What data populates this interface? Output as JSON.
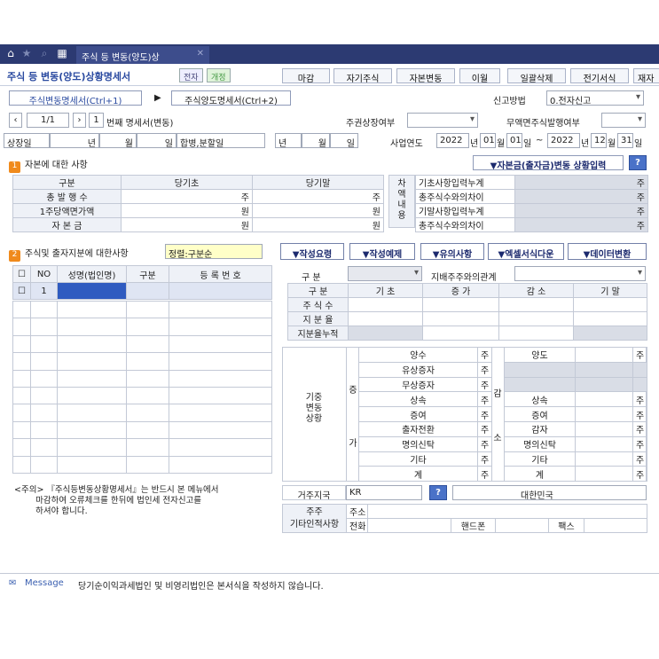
{
  "tab": {
    "title": "주식 등 변동(양도)상",
    "close": "✕"
  },
  "header": {
    "title": "주식 등 변동(양도)상황명세서",
    "badge1": "전자",
    "badge2": "개정",
    "buttons": [
      "마감",
      "자기주식",
      "자본변동",
      "이월",
      "일괄삭제",
      "전기서식",
      "재자"
    ]
  },
  "nav": {
    "form1": "주식변동명세서(Ctrl+1)",
    "arrow": "▶",
    "form2": "주식양도명세서(Ctrl+2)",
    "report_label": "신고방법",
    "report_value": "0.전자신고"
  },
  "pager": {
    "current": "1/1",
    "num": "1",
    "label": "번째 명세서(변동)",
    "listed_label": "주권상장여부",
    "scrip_label": "무액면주식발행여부"
  },
  "dates": {
    "listed": "상장일",
    "year": "년",
    "month": "월",
    "day": "일",
    "merge": "합병,분할일",
    "year2": "년",
    "month2": "월",
    "day2": "일",
    "fiscal_label": "사업연도",
    "y1": "2022",
    "m1": "01",
    "d1": "01",
    "y2": "2022",
    "m2": "12",
    "d2": "31",
    "tilde": "~",
    "yl": "년",
    "ml": "월",
    "dl": "일"
  },
  "capital": {
    "section_num": "1",
    "section": "자본에 대한 사항",
    "input_btn": "▼자본금(출자금)변동 상황입력",
    "q": "?",
    "headers": [
      "구분",
      "당기초",
      "당기말"
    ],
    "rows": [
      {
        "label": "총 발 행 수",
        "unit": "주"
      },
      {
        "label": "1주당액면가액",
        "unit": "원"
      },
      {
        "label": "자 본 금",
        "unit": "원"
      }
    ],
    "diff_label": [
      "차",
      "액",
      "내",
      "용"
    ],
    "diff_rows": [
      {
        "label": "기초사항입력누계",
        "unit": "주"
      },
      {
        "label": "총주식수와의차이",
        "unit": "주"
      },
      {
        "label": "기말사항입력누계",
        "unit": "주"
      },
      {
        "label": "총주식수와의차이",
        "unit": "주"
      }
    ]
  },
  "shares": {
    "section_num": "2",
    "section": "주식및 출자지분에 대한사항",
    "sort": "정렬:구분순",
    "buttons": [
      "▼작성요령",
      "▼작성예제",
      "▼유의사항",
      "▼엑셀서식다운",
      "▼데이터변환"
    ],
    "cols": [
      "NO",
      "성명(법인명)",
      "구분",
      "등 록 번 호"
    ],
    "first_no": "1",
    "type_label": "구 분",
    "major_label": "지배주주와의관계",
    "mid_headers": [
      "구 분",
      "기 초",
      "증 가",
      "감 소",
      "기 말"
    ],
    "mid_rows": [
      "주 식 수",
      "지 분 율",
      "지분율누적"
    ],
    "change_label": "기중\n변동\n상황",
    "inc": "증",
    "inc2": "가",
    "dec": "감",
    "dec2": "소",
    "inc_items": [
      "양수",
      "유상증자",
      "무상증자",
      "상속",
      "증여",
      "출자전환",
      "명의신탁",
      "기타",
      "계"
    ],
    "dec_items": [
      "양도",
      "",
      "",
      "상속",
      "증여",
      "감자",
      "명의신탁",
      "기타",
      "계"
    ],
    "unit": "주",
    "note": "<주의> 『주식등변동상황명세서』는 반드시 본 메뉴에서\n        마감하여 오류체크를 한뒤에 법인세 전자신고를\n        하셔야 합니다.",
    "country_label": "거주지국",
    "country_code": "KR",
    "country_name": "대한민국",
    "shareholder": "주주",
    "other_info": "기타인적사항",
    "address": "주소",
    "phone": "전화",
    "mobile": "핸드폰",
    "fax": "팩스"
  },
  "message": {
    "icon": "chat-icon",
    "label": "Message",
    "text": "당기순이익과세법인 및 비영리법인은 본서식을 작성하지 않습니다."
  }
}
